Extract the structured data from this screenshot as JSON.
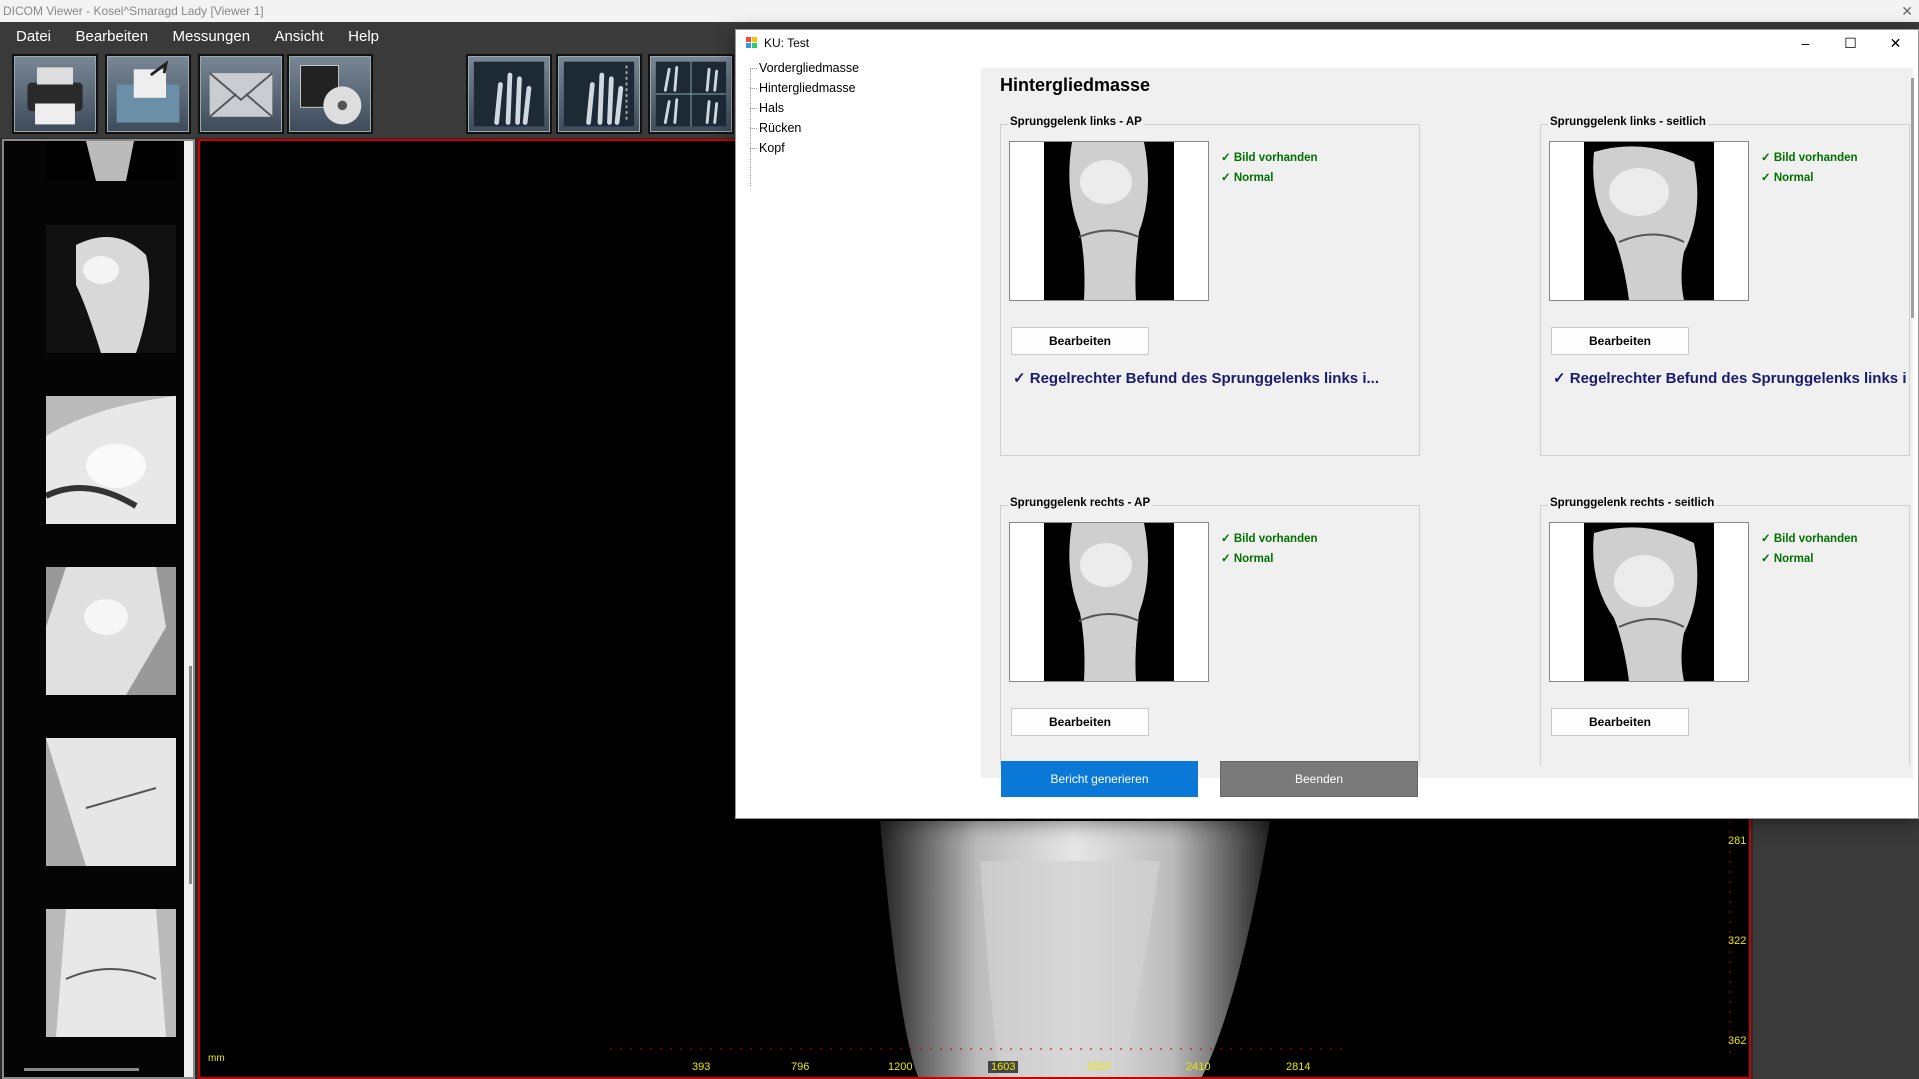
{
  "viewer": {
    "title": "DICOM Viewer - Kosel^Smaragd Lady [Viewer 1]",
    "menu": [
      "Datei",
      "Bearbeiten",
      "Messungen",
      "Ansicht",
      "Help"
    ],
    "toolbar_icons": [
      "print-icon",
      "export-icon",
      "mail-icon",
      "burn-cd-icon",
      "layout-1x1-icon",
      "layout-ruler-icon",
      "layout-2x2-icon"
    ],
    "axis_unit": "mm",
    "x_ticks": [
      "393",
      "796",
      "1200",
      "1603",
      "2007",
      "2410",
      "2814"
    ],
    "y_ticks": [
      "281",
      "322",
      "362"
    ]
  },
  "dialog": {
    "title": "KU: Test",
    "controls": [
      "minimize-icon",
      "maximize-icon",
      "close-icon"
    ],
    "tree": [
      "Vordergliedmasse",
      "Hintergliedmasse",
      "Hals",
      "Rücken",
      "Kopf"
    ],
    "section_title": "Hintergliedmasse",
    "cards": [
      {
        "title": "Sprunggelenk links - AP",
        "status1": "✓ Bild vorhanden",
        "status2": "✓ Normal",
        "button": "Bearbeiten",
        "finding": "✓ Regelrechter Befund des Sprunggelenks links i..."
      },
      {
        "title": "Sprunggelenk links - seitlich",
        "status1": "✓ Bild vorhanden",
        "status2": "✓ Normal",
        "button": "Bearbeiten",
        "finding": "✓ Regelrechter Befund des Sprunggelenks links i..."
      },
      {
        "title": "Sprunggelenk rechts - AP",
        "status1": "✓ Bild vorhanden",
        "status2": "✓ Normal",
        "button": "Bearbeiten",
        "finding": ""
      },
      {
        "title": "Sprunggelenk rechts - seitlich",
        "status1": "✓ Bild vorhanden",
        "status2": "✓ Normal",
        "button": "Bearbeiten",
        "finding": ""
      }
    ],
    "buttons": {
      "generate": "Bericht generieren",
      "close": "Beenden"
    }
  }
}
